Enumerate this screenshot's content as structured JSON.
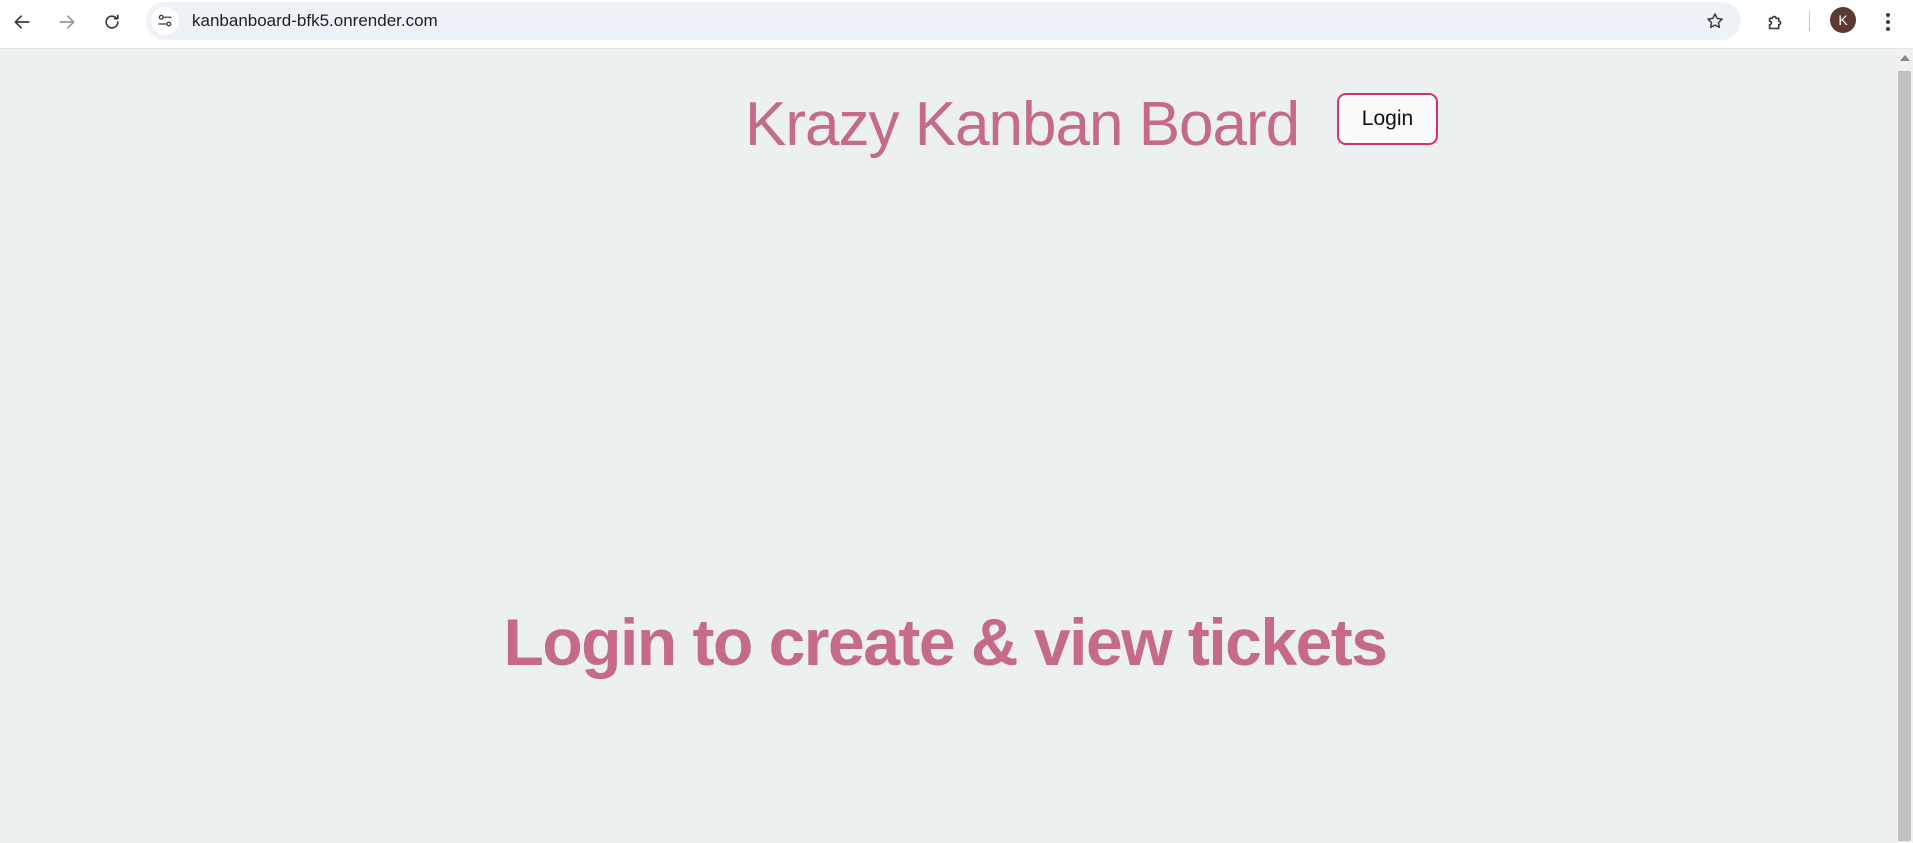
{
  "browser": {
    "url": "kanbanboard-bfk5.onrender.com",
    "profile_initial": "K",
    "icons": {
      "back": "arrow-left-icon",
      "forward": "arrow-right-icon",
      "reload": "reload-icon",
      "site_info": "tune-icon",
      "bookmark": "star-icon",
      "extensions": "puzzle-icon",
      "menu": "kebab-menu-icon"
    }
  },
  "header": {
    "title": "Krazy Kanban Board",
    "login_label": "Login"
  },
  "main": {
    "message": "Login to create & view tickets"
  },
  "colors": {
    "accent_text": "#c56a8a",
    "button_border": "#d1336f",
    "page_background": "#ecf0f1",
    "avatar_background": "#5a3a32"
  }
}
